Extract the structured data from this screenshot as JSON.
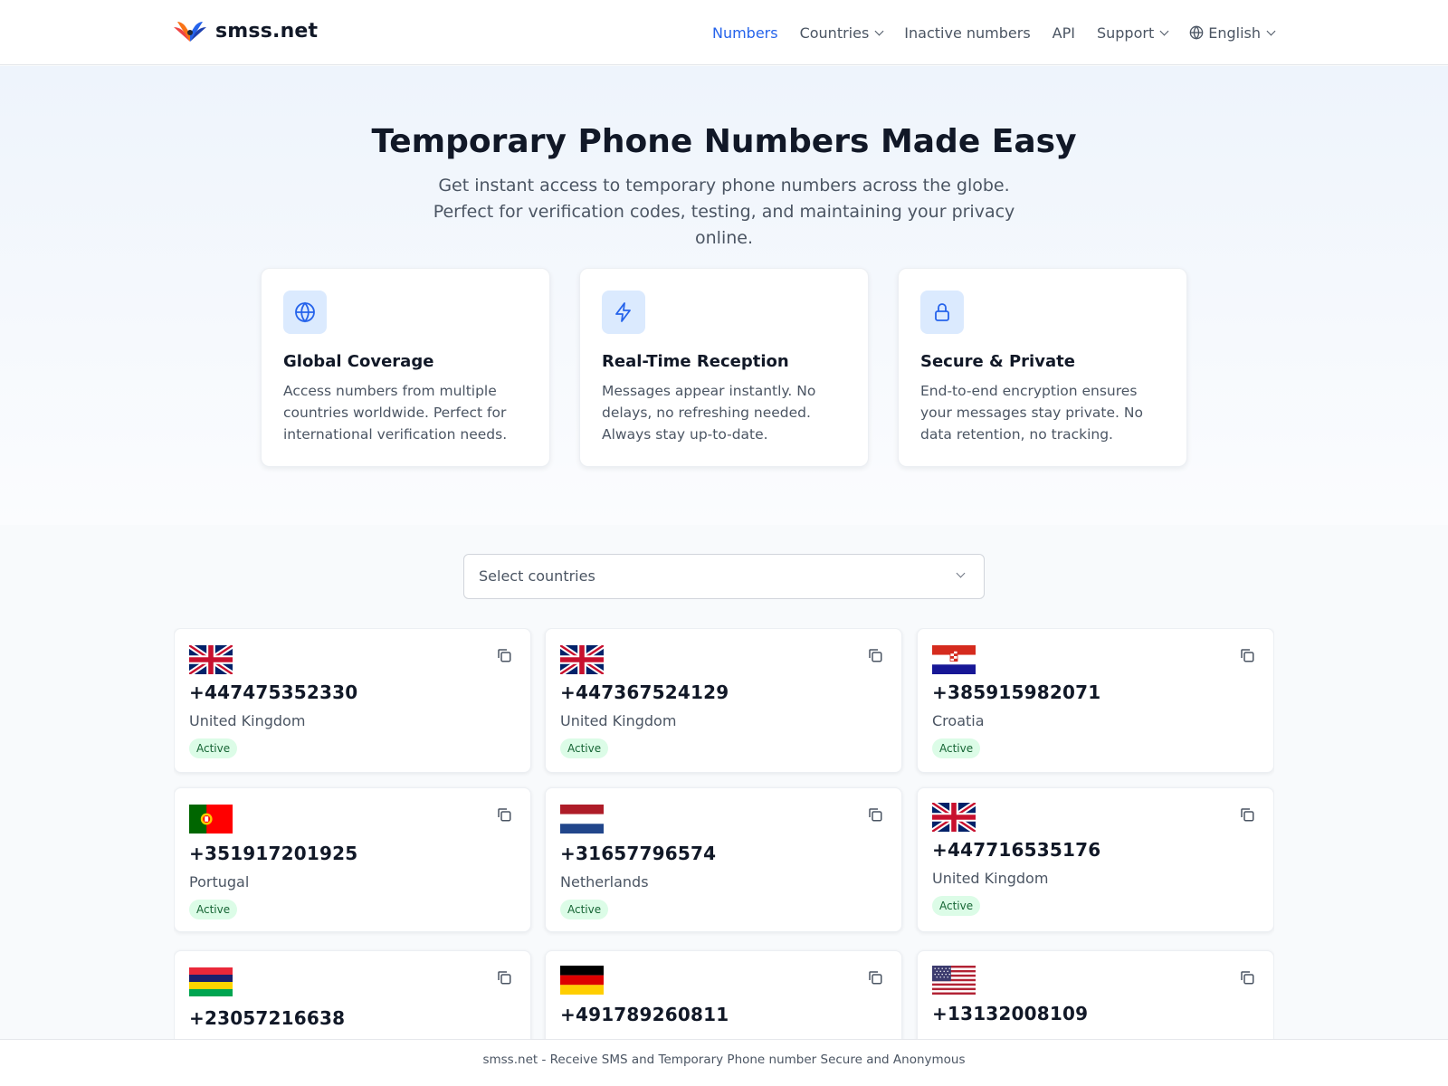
{
  "brand": {
    "name": "smss.net"
  },
  "nav": {
    "items": [
      {
        "label": "Numbers",
        "active": true,
        "dropdown": false
      },
      {
        "label": "Countries",
        "active": false,
        "dropdown": true
      },
      {
        "label": "Inactive numbers",
        "active": false,
        "dropdown": false
      },
      {
        "label": "API",
        "active": false,
        "dropdown": false
      },
      {
        "label": "Support",
        "active": false,
        "dropdown": true
      }
    ],
    "language": "English"
  },
  "hero": {
    "title": "Temporary Phone Numbers Made Easy",
    "subtitle": "Get instant access to temporary phone numbers across the globe. Perfect for verification codes, testing, and maintaining your privacy online."
  },
  "features": [
    {
      "icon": "globe-icon",
      "title": "Global Coverage",
      "desc": "Access numbers from multiple countries worldwide. Perfect for international verification needs."
    },
    {
      "icon": "lightning-icon",
      "title": "Real-Time Reception",
      "desc": "Messages appear instantly. No delays, no refreshing needed. Always stay up-to-date."
    },
    {
      "icon": "lock-icon",
      "title": "Secure & Private",
      "desc": "End-to-end encryption ensures your messages stay private. No data retention, no tracking."
    }
  ],
  "country_select": {
    "placeholder": "Select countries"
  },
  "numbers": [
    {
      "phone": "+447475352330",
      "country": "United Kingdom",
      "flag": "uk",
      "status": "Active"
    },
    {
      "phone": "+447367524129",
      "country": "United Kingdom",
      "flag": "uk",
      "status": "Active"
    },
    {
      "phone": "+385915982071",
      "country": "Croatia",
      "flag": "hr",
      "status": "Active"
    },
    {
      "phone": "+351917201925",
      "country": "Portugal",
      "flag": "pt",
      "status": "Active"
    },
    {
      "phone": "+31657796574",
      "country": "Netherlands",
      "flag": "nl",
      "status": "Active"
    },
    {
      "phone": "+447716535176",
      "country": "United Kingdom",
      "flag": "uk",
      "status": "Active"
    },
    {
      "phone": "+23057216638",
      "country": "",
      "flag": "mu",
      "status": ""
    },
    {
      "phone": "+491789260811",
      "country": "",
      "flag": "de",
      "status": ""
    },
    {
      "phone": "+13132008109",
      "country": "",
      "flag": "us",
      "status": ""
    }
  ],
  "footer": {
    "text": "smss.net - Receive SMS and Temporary Phone number Secure and Anonymous"
  }
}
